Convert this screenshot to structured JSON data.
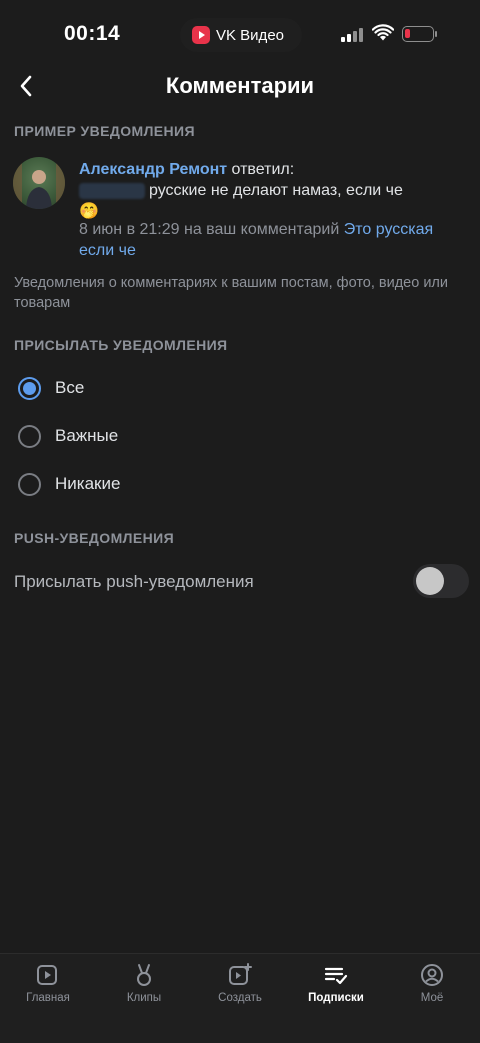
{
  "status_bar": {
    "time": "00:14",
    "app_name": "VK Видео"
  },
  "header": {
    "title": "Комментарии",
    "back_icon": "chevron-left-icon"
  },
  "example": {
    "section_title": "ПРИМЕР УВЕДОМЛЕНИЯ",
    "author": "Александр Ремонт",
    "action": "ответил:",
    "message": "русские не делают намаз, если че",
    "emoji": "🤭",
    "meta": "8 июн в 21:29 на ваш комментарий",
    "link": "Это русская если че"
  },
  "description": "Уведомления о комментариях к вашим постам, фото, видео или товарам",
  "send_section": {
    "title": "ПРИСЫЛАТЬ УВЕДОМЛЕНИЯ",
    "options": [
      {
        "label": "Все",
        "checked": true
      },
      {
        "label": "Важные",
        "checked": false
      },
      {
        "label": "Никакие",
        "checked": false
      }
    ]
  },
  "push_section": {
    "title": "PUSH-УВЕДОМЛЕНИЯ",
    "toggle_label": "Присылать push-уведомления",
    "enabled": false
  },
  "tabs": [
    {
      "label": "Главная",
      "icon": "play-square-icon",
      "active": false
    },
    {
      "label": "Клипы",
      "icon": "clips-icon",
      "active": false
    },
    {
      "label": "Создать",
      "icon": "create-video-icon",
      "active": false
    },
    {
      "label": "Подписки",
      "icon": "subscriptions-icon",
      "active": true
    },
    {
      "label": "Моё",
      "icon": "profile-icon",
      "active": false
    }
  ],
  "colors": {
    "background": "#1c1c1c",
    "accent": "#5d9ced",
    "link": "#71aaeb"
  }
}
